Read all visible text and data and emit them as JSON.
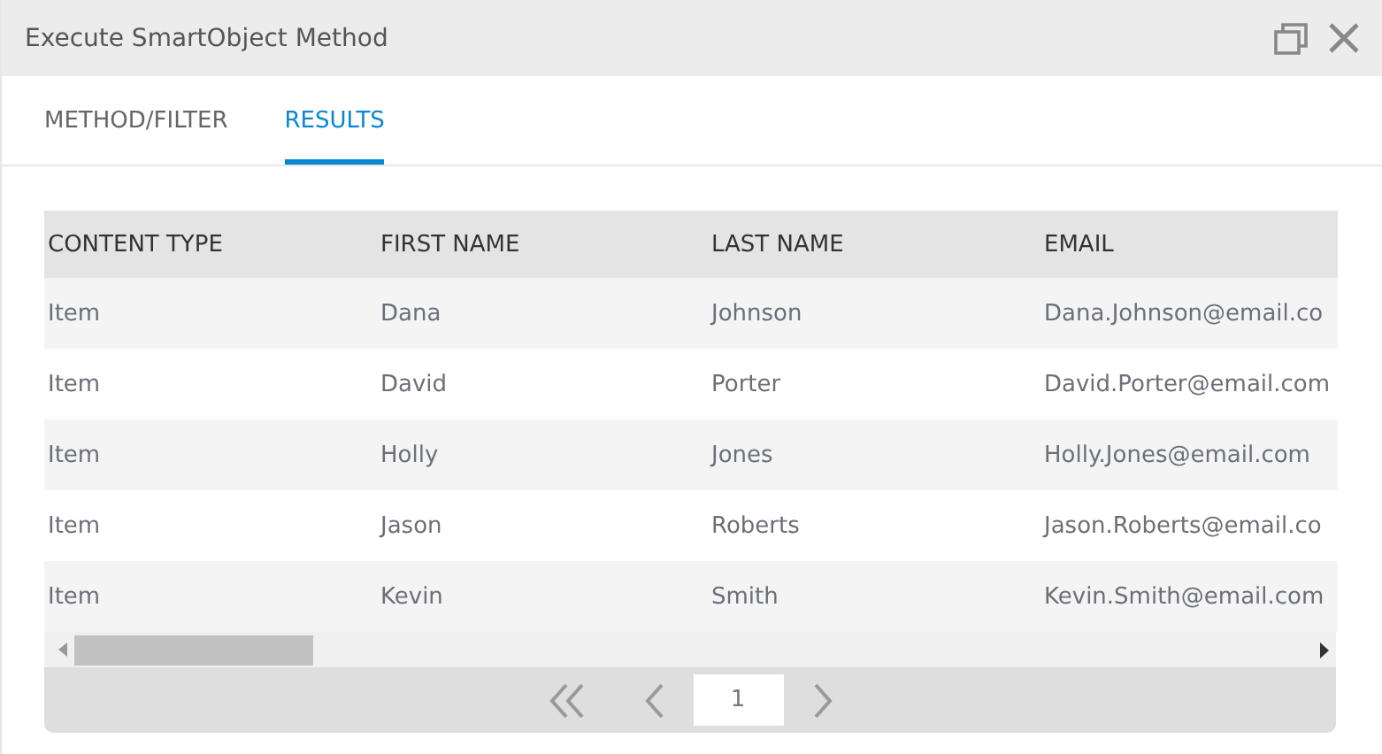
{
  "window": {
    "title": "Execute SmartObject Method"
  },
  "tabs": [
    {
      "label": "METHOD/FILTER",
      "selected": false
    },
    {
      "label": "RESULTS",
      "selected": true
    }
  ],
  "table": {
    "columns": [
      "CONTENT TYPE",
      "FIRST NAME",
      "LAST NAME",
      "EMAIL"
    ],
    "rows": [
      [
        "Item",
        "Dana",
        "Johnson",
        "Dana.Johnson@email.co"
      ],
      [
        "Item",
        "David",
        "Porter",
        "David.Porter@email.com"
      ],
      [
        "Item",
        "Holly",
        "Jones",
        "Holly.Jones@email.com"
      ],
      [
        "Item",
        "Jason",
        "Roberts",
        "Jason.Roberts@email.co"
      ],
      [
        "Item",
        "Kevin",
        "Smith",
        "Kevin.Smith@email.com"
      ]
    ]
  },
  "pager": {
    "page": "1"
  }
}
